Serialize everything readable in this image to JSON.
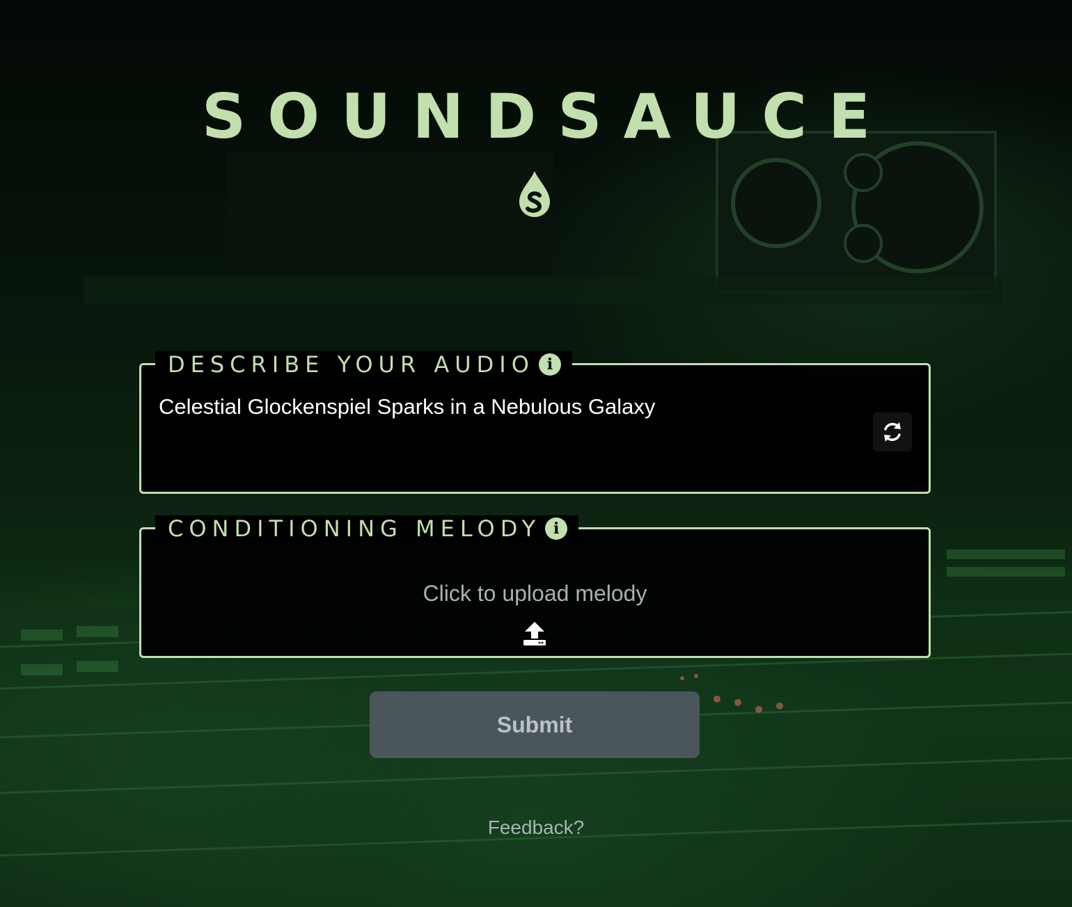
{
  "app": {
    "title": "SOUNDSAUCE",
    "accent_color": "#c2dfae",
    "logo_icon": "sauce-drop-s-logo"
  },
  "describe": {
    "label": "DESCRIBE YOUR AUDIO",
    "info_icon": "info-icon",
    "value": "Celestial Glockenspiel Sparks in a Nebulous Galaxy",
    "refresh_icon": "refresh-icon"
  },
  "melody": {
    "label": "CONDITIONING MELODY",
    "info_icon": "info-icon",
    "upload_text": "Click to upload melody",
    "upload_icon": "upload-icon"
  },
  "submit": {
    "label": "Submit",
    "color": "#4a565a"
  },
  "footer": {
    "feedback_label": "Feedback?"
  }
}
